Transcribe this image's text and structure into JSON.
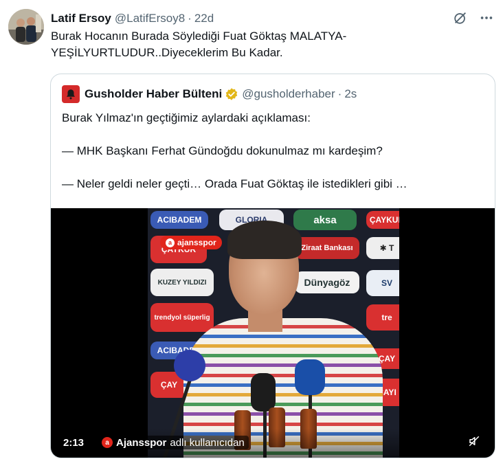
{
  "tweet": {
    "author_name": "Latif Ersoy",
    "author_handle": "@LatifErsoy8",
    "separator": "·",
    "time": "22d",
    "text": "Burak Hocanın Burada Söylediği Fuat Göktaş MALATYA-YEŞİLYURTLUDUR..Diyeceklerim Bu Kadar.",
    "icons": {
      "grok": "slashed-circle-icon",
      "more": "more-horizontal-icon"
    }
  },
  "quote": {
    "author_name": "Gusholder Haber Bülteni",
    "author_handle": "@gusholderhaber",
    "separator": "·",
    "time": "2s",
    "verified_color": "#e2b719",
    "logo_color": "#d42a2a",
    "lines": [
      "Burak Yılmaz'ın geçtiğimiz aylardaki açıklaması:",
      "— MHK Başkanı Ferhat Gündoğdu dokunulmaz mı kardeşim?",
      "— Neler geldi neler geçti… Orada Fuat Göktaş ile istedikleri gibi …"
    ],
    "video": {
      "watermark": "ajansspor",
      "duration": "2:13",
      "source_name": "Ajansspor",
      "source_suffix": "adlı kullanıcıdan",
      "sponsors": {
        "acibadem": "ACIBADEM",
        "gloria": "GLORIA",
        "aksa": "aksa",
        "caykur": "ÇAYKUR",
        "ziraat": "Ziraat Bankası",
        "kuzey": "KUZEY YILDIZI",
        "dunyagoz": "Dünyagöz",
        "trendyol": "trendyol süperlig",
        "acibadem2": "ACIBADEM",
        "cay": "ÇAY",
        "cay2": "ÇAY",
        "cay3": "ÇAYI"
      },
      "icons": {
        "mute": "muted-speaker-icon"
      }
    }
  },
  "colors": {
    "text": "#0f1419",
    "secondary": "#536471",
    "border": "#cfd9de",
    "accent_red": "#e1251b"
  }
}
